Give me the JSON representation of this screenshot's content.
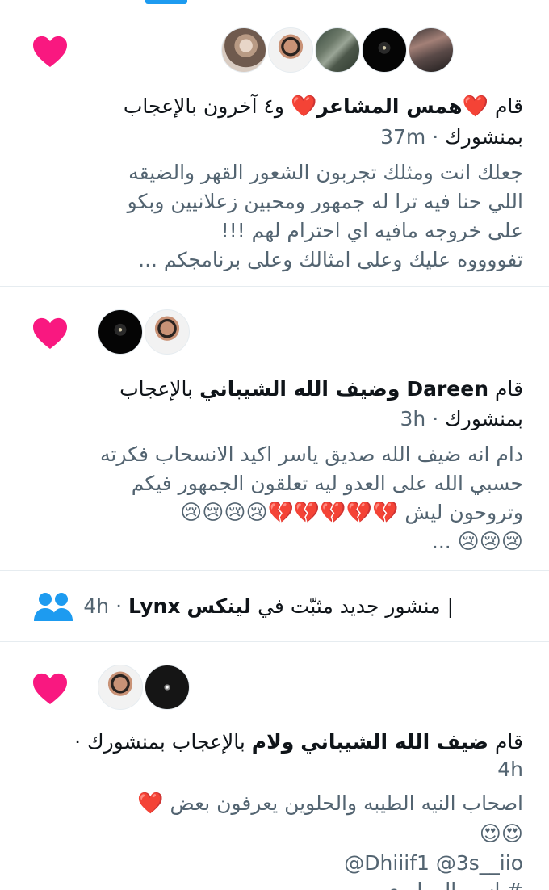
{
  "colors": {
    "like_pink": "#f91880",
    "accent_blue": "#1d9bf0",
    "muted_text": "#536471",
    "divider": "#e6ecf0"
  },
  "icons": {
    "like": "heart-icon",
    "pinned_post": "people-group-icon"
  },
  "notifications": [
    {
      "type": "like",
      "prefix": "قام",
      "user1": "همس المشاعر",
      "user1_emoji": "❤️",
      "others": "و٤ آخرون",
      "action": "بالإعجاب",
      "line2": "بمنشورك",
      "time": "37m",
      "content_lines": [
        "جعلك انت ومثلك تجربون الشعور القهر والضيقه",
        "اللي حنا فيه ترا له جمهور ومحبين زعلانيين وبكو",
        "على خروجه مافيه اي احترام لهم !!!",
        "تفووووه عليك وعلى امثالك وعلى برنامجكم ..."
      ]
    },
    {
      "type": "like",
      "prefix": "قام",
      "user1": "Dareen",
      "joiner": "و",
      "user2": "ضيف الله الشيباني",
      "action": "بالإعجاب",
      "line2": "بمنشورك",
      "time": "3h",
      "content_lines": [
        "دام انه ضيف الله صديق ياسر اكيد الانسحاب فكرته",
        "حسبي الله على العدو ليه تعلقون الجمهور فيكم",
        "وتروحون ليش",
        "..."
      ],
      "emoji_row_1": "💔💔💔💔💔😢😢😢😢",
      "emoji_row_2": "😢😢😢"
    },
    {
      "type": "pinned",
      "source": "Lynx",
      "text": "| منشور جديد مثبّت في",
      "community": "لينكس",
      "time": "4h"
    },
    {
      "type": "like",
      "prefix": "قام",
      "user1": "ضيف الله الشيباني",
      "joiner": "و",
      "user2": "لام",
      "action": "بالإعجاب بمنشورك ·",
      "time": "4h",
      "content_line": "اصحاب النيه الطيبه والحلوين يعرفون بعض",
      "content_heart": "❤️",
      "emoji_row": "😍😍",
      "mentions": "@Dhiiif1 @3s__iio",
      "hashtag_partial": "#ياسر_المطيري"
    }
  ]
}
